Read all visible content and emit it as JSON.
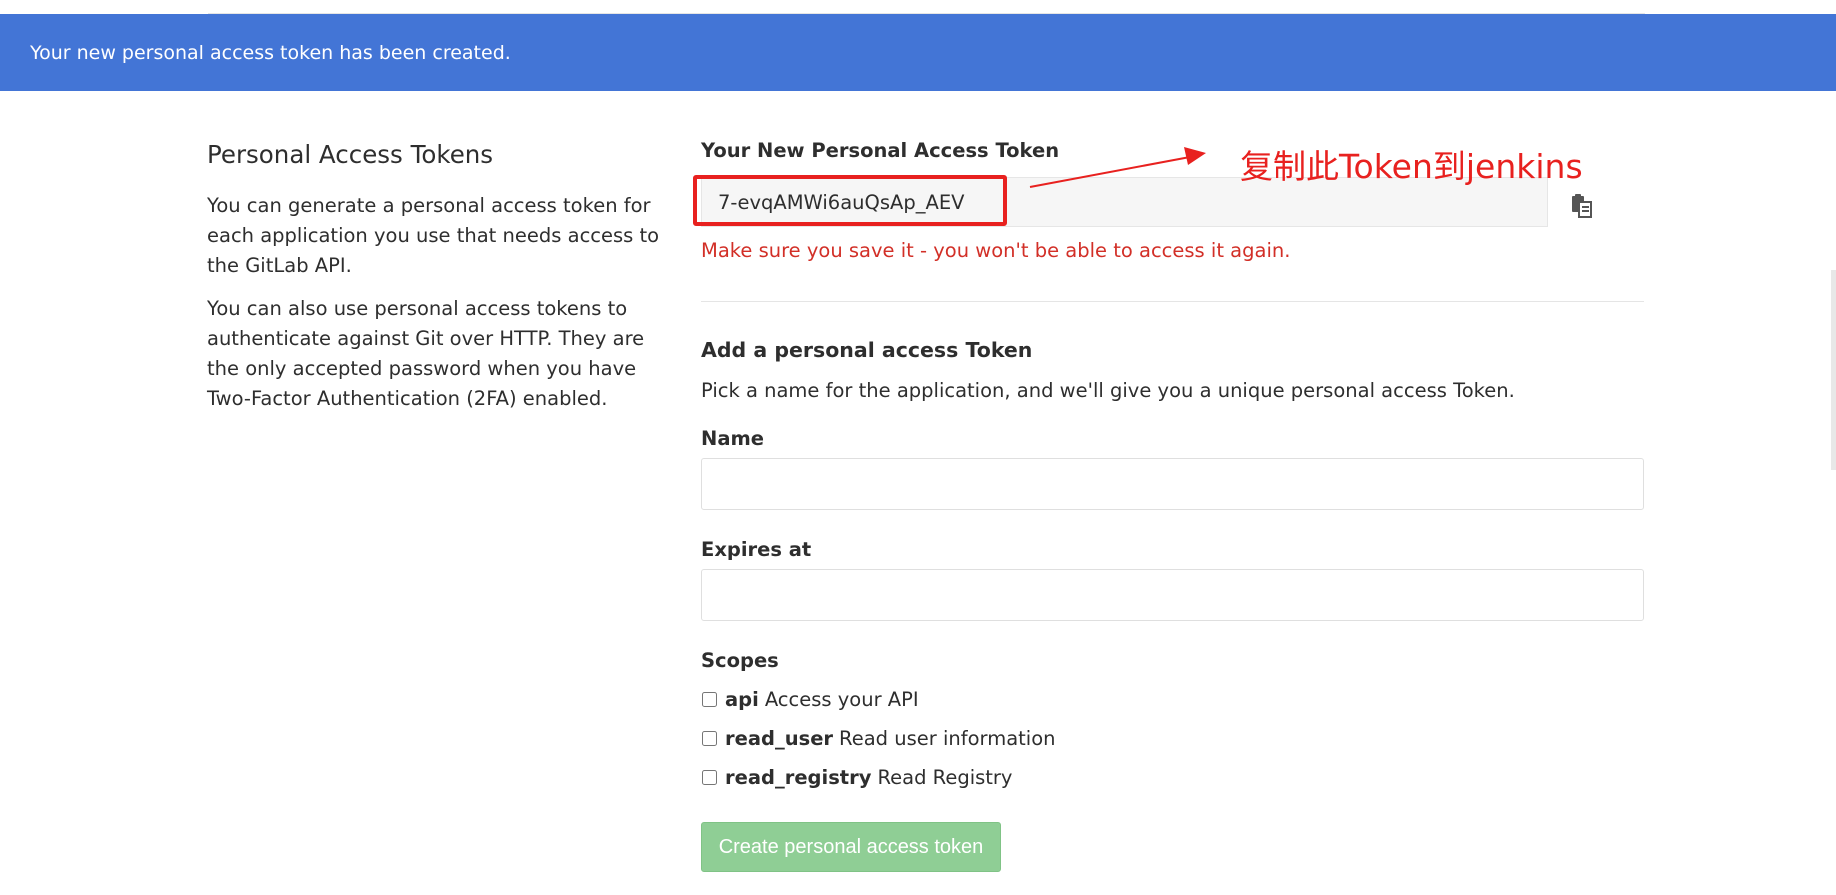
{
  "flash": {
    "message": "Your new personal access token has been created."
  },
  "sidebar": {
    "title": "Personal Access Tokens",
    "paragraph_1": "You can generate a personal access token for each application you use that needs access to the GitLab API.",
    "paragraph_2": "You can also use personal access tokens to authenticate against Git over HTTP. They are the only accepted password when you have Two-Factor Authentication (2FA) enabled."
  },
  "new_token": {
    "label": "Your New Personal Access Token",
    "value": "7-evqAMWi6auQsAp_AEV",
    "warning": "Make sure you save it - you won't be able to access it again.",
    "copy_icon": "clipboard-icon"
  },
  "form": {
    "heading": "Add a personal access Token",
    "description": "Pick a name for the application, and we'll give you a unique personal access Token.",
    "name_label": "Name",
    "name_value": "",
    "expires_label": "Expires at",
    "expires_value": "",
    "scopes_label": "Scopes",
    "scopes": [
      {
        "name": "api",
        "description": "Access your API",
        "checked": false
      },
      {
        "name": "read_user",
        "description": "Read user information",
        "checked": false
      },
      {
        "name": "read_registry",
        "description": "Read Registry",
        "checked": false
      }
    ],
    "submit_label": "Create personal access token"
  },
  "annotation": {
    "text": "复制此Token到jenkins",
    "color": "#e8211f"
  },
  "colors": {
    "flash_bg": "#4375d6",
    "warning": "#d22f27",
    "submit_bg": "#8fce95"
  }
}
